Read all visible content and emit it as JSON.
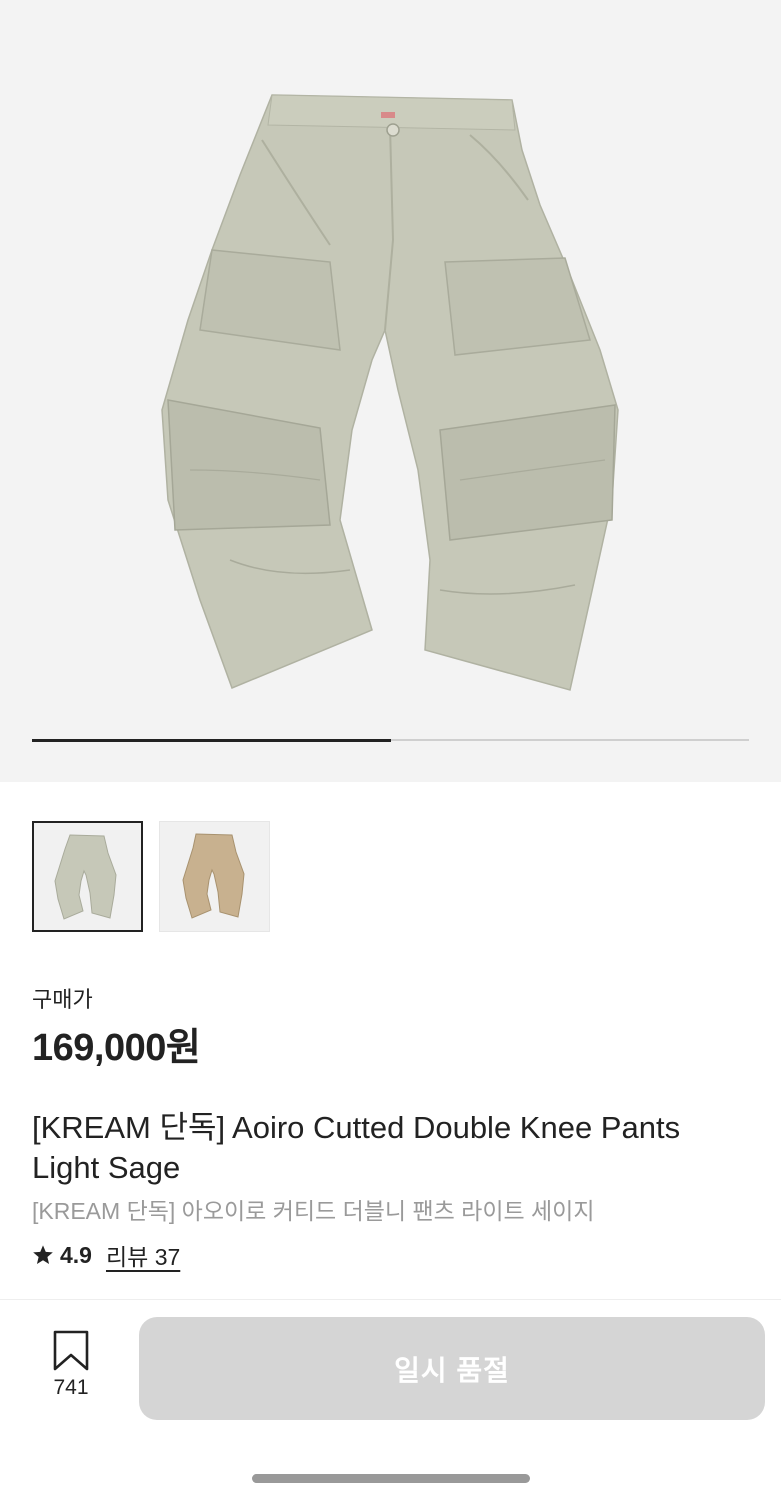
{
  "gallery": {
    "image_count": 2,
    "current_index": 1,
    "progress_fraction": 0.5,
    "thumbnails": [
      {
        "color": "#c9cbbd",
        "selected": true
      },
      {
        "color": "#c8b18f",
        "selected": false
      }
    ]
  },
  "price": {
    "label": "구매가",
    "value": "169,000원"
  },
  "product": {
    "title": "[KREAM 단독] Aoiro Cutted Double Knee Pants Light Sage",
    "subtitle": "[KREAM 단독] 아오이로 커티드 더블니 팬츠 라이트 세이지",
    "rating": "4.9",
    "reviews_label": "리뷰 37"
  },
  "footer": {
    "bookmark_count": "741",
    "buy_button_label": "일시 품절"
  },
  "colors": {
    "pants_main": "#c6c8b8",
    "pants_shadow": "#a9ab9b",
    "thumb_beige": "#c8b18f",
    "button_disabled": "#d5d5d5"
  }
}
